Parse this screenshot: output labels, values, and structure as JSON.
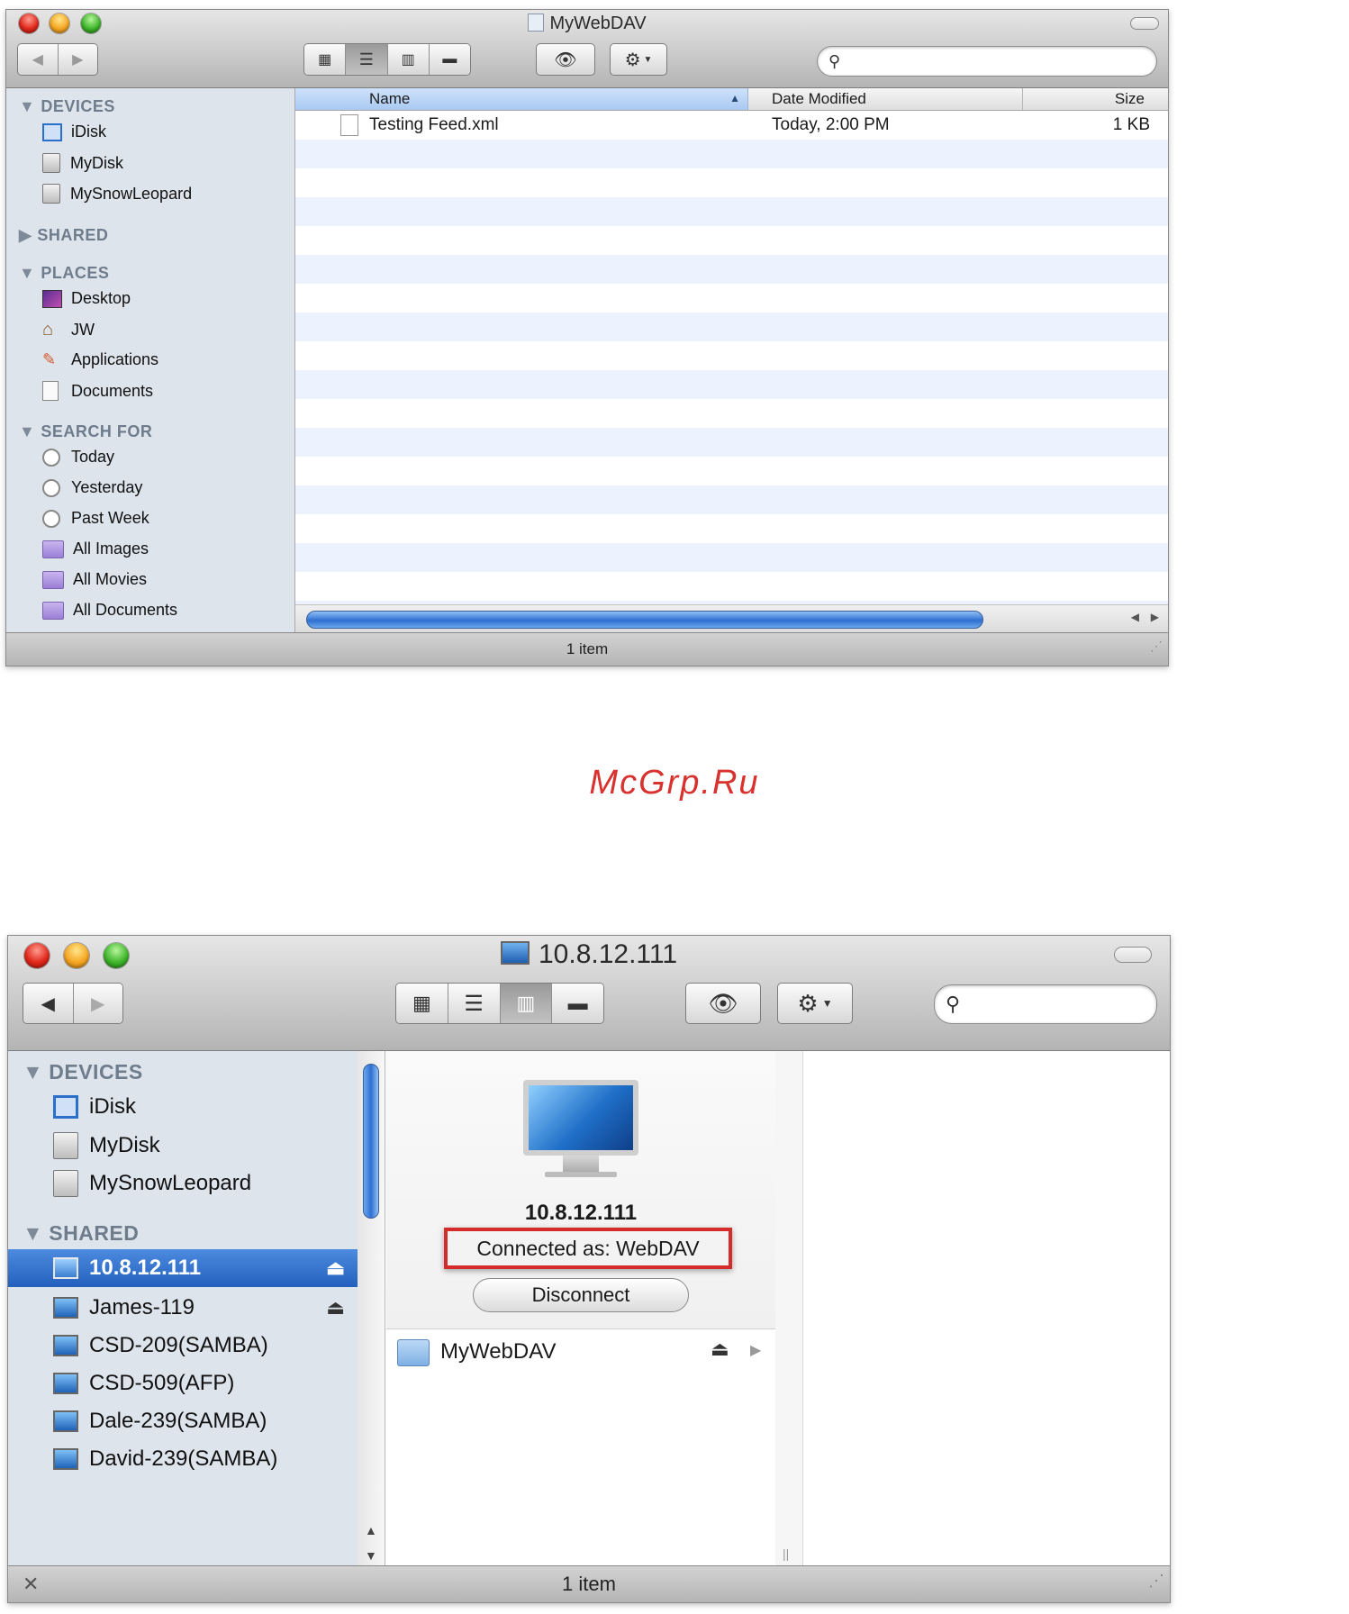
{
  "watermark": "McGrp.Ru",
  "window1": {
    "title": "MyWebDAV",
    "view_modes": [
      "icon-view",
      "list-view",
      "column-view",
      "cover-flow-view"
    ],
    "active_view": "list-view",
    "search": {
      "placeholder": ""
    },
    "sidebar": {
      "sections": [
        {
          "label": "DEVICES",
          "expanded": true,
          "items": [
            {
              "label": "iDisk",
              "icon": "idisk-icon"
            },
            {
              "label": "MyDisk",
              "icon": "hard-disk-icon"
            },
            {
              "label": "MySnowLeopard",
              "icon": "hard-disk-icon"
            }
          ]
        },
        {
          "label": "SHARED",
          "expanded": false,
          "items": []
        },
        {
          "label": "PLACES",
          "expanded": true,
          "items": [
            {
              "label": "Desktop",
              "icon": "desktop-icon"
            },
            {
              "label": "JW",
              "icon": "home-icon"
            },
            {
              "label": "Applications",
              "icon": "applications-icon"
            },
            {
              "label": "Documents",
              "icon": "documents-icon"
            }
          ]
        },
        {
          "label": "SEARCH FOR",
          "expanded": true,
          "items": [
            {
              "label": "Today",
              "icon": "clock-icon"
            },
            {
              "label": "Yesterday",
              "icon": "clock-icon"
            },
            {
              "label": "Past Week",
              "icon": "clock-icon"
            },
            {
              "label": "All Images",
              "icon": "smart-folder-icon"
            },
            {
              "label": "All Movies",
              "icon": "smart-folder-icon"
            },
            {
              "label": "All Documents",
              "icon": "smart-folder-icon"
            }
          ]
        }
      ]
    },
    "columns": {
      "name": "Name",
      "date": "Date Modified",
      "size": "Size"
    },
    "files": [
      {
        "name": "Testing Feed.xml",
        "date": "Today, 2:00 PM",
        "size": "1 KB"
      }
    ],
    "status": "1 item"
  },
  "window2": {
    "title": "10.8.12.111",
    "view_modes": [
      "icon-view",
      "list-view",
      "column-view",
      "cover-flow-view"
    ],
    "active_view": "column-view",
    "search": {
      "placeholder": ""
    },
    "sidebar": {
      "devices_label": "DEVICES",
      "devices": [
        {
          "label": "iDisk",
          "icon": "idisk-icon"
        },
        {
          "label": "MyDisk",
          "icon": "hard-disk-icon"
        },
        {
          "label": "MySnowLeopard",
          "icon": "hard-disk-icon"
        }
      ],
      "shared_label": "SHARED",
      "shared": [
        {
          "label": "10.8.12.111",
          "selected": true,
          "eject": true
        },
        {
          "label": "James-119",
          "selected": false,
          "eject": true
        },
        {
          "label": "CSD-209(SAMBA)",
          "selected": false,
          "eject": false
        },
        {
          "label": "CSD-509(AFP)",
          "selected": false,
          "eject": false
        },
        {
          "label": "Dale-239(SAMBA)",
          "selected": false,
          "eject": false
        },
        {
          "label": "David-239(SAMBA)",
          "selected": false,
          "eject": false
        }
      ]
    },
    "server": {
      "name": "10.8.12.111",
      "connected_as": "Connected as: WebDAV",
      "disconnect_label": "Disconnect",
      "highlight_color": "#d42b2b"
    },
    "volumes": [
      {
        "label": "MyWebDAV"
      }
    ],
    "status": "1 item"
  },
  "colors": {
    "selection": "#2f6fc6",
    "sidebar_bg": "#dde4ec",
    "header_sort": "#b9d3f5"
  }
}
